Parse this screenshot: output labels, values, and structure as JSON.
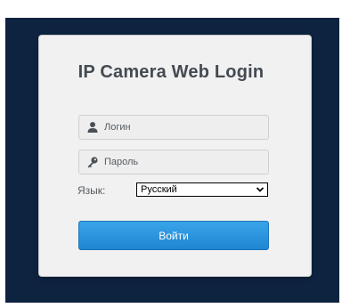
{
  "login_card": {
    "title": "IP Camera Web Login",
    "username": {
      "placeholder": "Логин",
      "value": "",
      "icon": "user-icon"
    },
    "password": {
      "placeholder": "Пароль",
      "value": "",
      "icon": "key-icon"
    },
    "language": {
      "label": "Язык:",
      "selected": "Русский"
    },
    "submit_label": "Войти"
  },
  "colors": {
    "backdrop": "#0e2340",
    "card": "#f1f1f1",
    "button": "#2a95de",
    "title": "#444a52"
  }
}
